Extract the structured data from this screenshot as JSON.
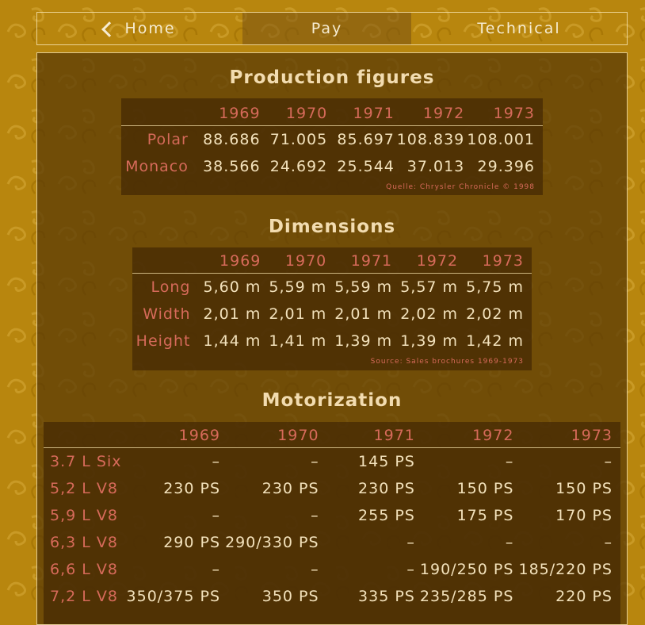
{
  "nav": {
    "home": "Home",
    "pay": "Pay",
    "technical": "Technical"
  },
  "production": {
    "title": "Production figures",
    "years": [
      "1969",
      "1970",
      "1971",
      "1972",
      "1973"
    ],
    "rows": [
      {
        "label": "Polar",
        "values": [
          "88.686",
          "71.005",
          "85.697",
          "108.839",
          "108.001"
        ]
      },
      {
        "label": "Monaco",
        "values": [
          "38.566",
          "24.692",
          "25.544",
          "37.013",
          "29.396"
        ]
      }
    ],
    "source": "Quelle: Chrysler Chronicle © 1998"
  },
  "dimensions": {
    "title": "Dimensions",
    "years": [
      "1969",
      "1970",
      "1971",
      "1972",
      "1973"
    ],
    "rows": [
      {
        "label": "Long",
        "values": [
          "5,60 m",
          "5,59 m",
          "5,59 m",
          "5,57 m",
          "5,75 m"
        ]
      },
      {
        "label": "Width",
        "values": [
          "2,01 m",
          "2,01 m",
          "2,01 m",
          "2,02 m",
          "2,02 m"
        ]
      },
      {
        "label": "Height",
        "values": [
          "1,44 m",
          "1,41 m",
          "1,39 m",
          "1,39 m",
          "1,42 m"
        ]
      }
    ],
    "source": "Source: Sales brochures 1969-1973"
  },
  "motorization": {
    "title": "Motorization",
    "years": [
      "1969",
      "1970",
      "1971",
      "1972",
      "1973"
    ],
    "rows": [
      {
        "label": "3.7 L Six",
        "values": [
          "–",
          "–",
          "145 PS",
          "–",
          "–"
        ]
      },
      {
        "label": "5,2 L V8",
        "values": [
          "230 PS",
          "230 PS",
          "230 PS",
          "150 PS",
          "150 PS"
        ]
      },
      {
        "label": "5,9 L V8",
        "values": [
          "–",
          "–",
          "255 PS",
          "175 PS",
          "170 PS"
        ]
      },
      {
        "label": "6,3 L V8",
        "values": [
          "290 PS",
          "290/330 PS",
          "–",
          "–",
          "–"
        ]
      },
      {
        "label": "6,6 L V8",
        "values": [
          "–",
          "–",
          "–",
          "190/250 PS",
          "185/220 PS"
        ]
      },
      {
        "label": "7,2 L V8",
        "values": [
          "350/375 PS",
          "350 PS",
          "335 PS",
          "235/285 PS",
          "220 PS"
        ]
      }
    ]
  },
  "colors": {
    "background": "#b8860e",
    "panel": "#583806",
    "accent_label": "#d66a5a",
    "text": "#f3e2bc"
  }
}
